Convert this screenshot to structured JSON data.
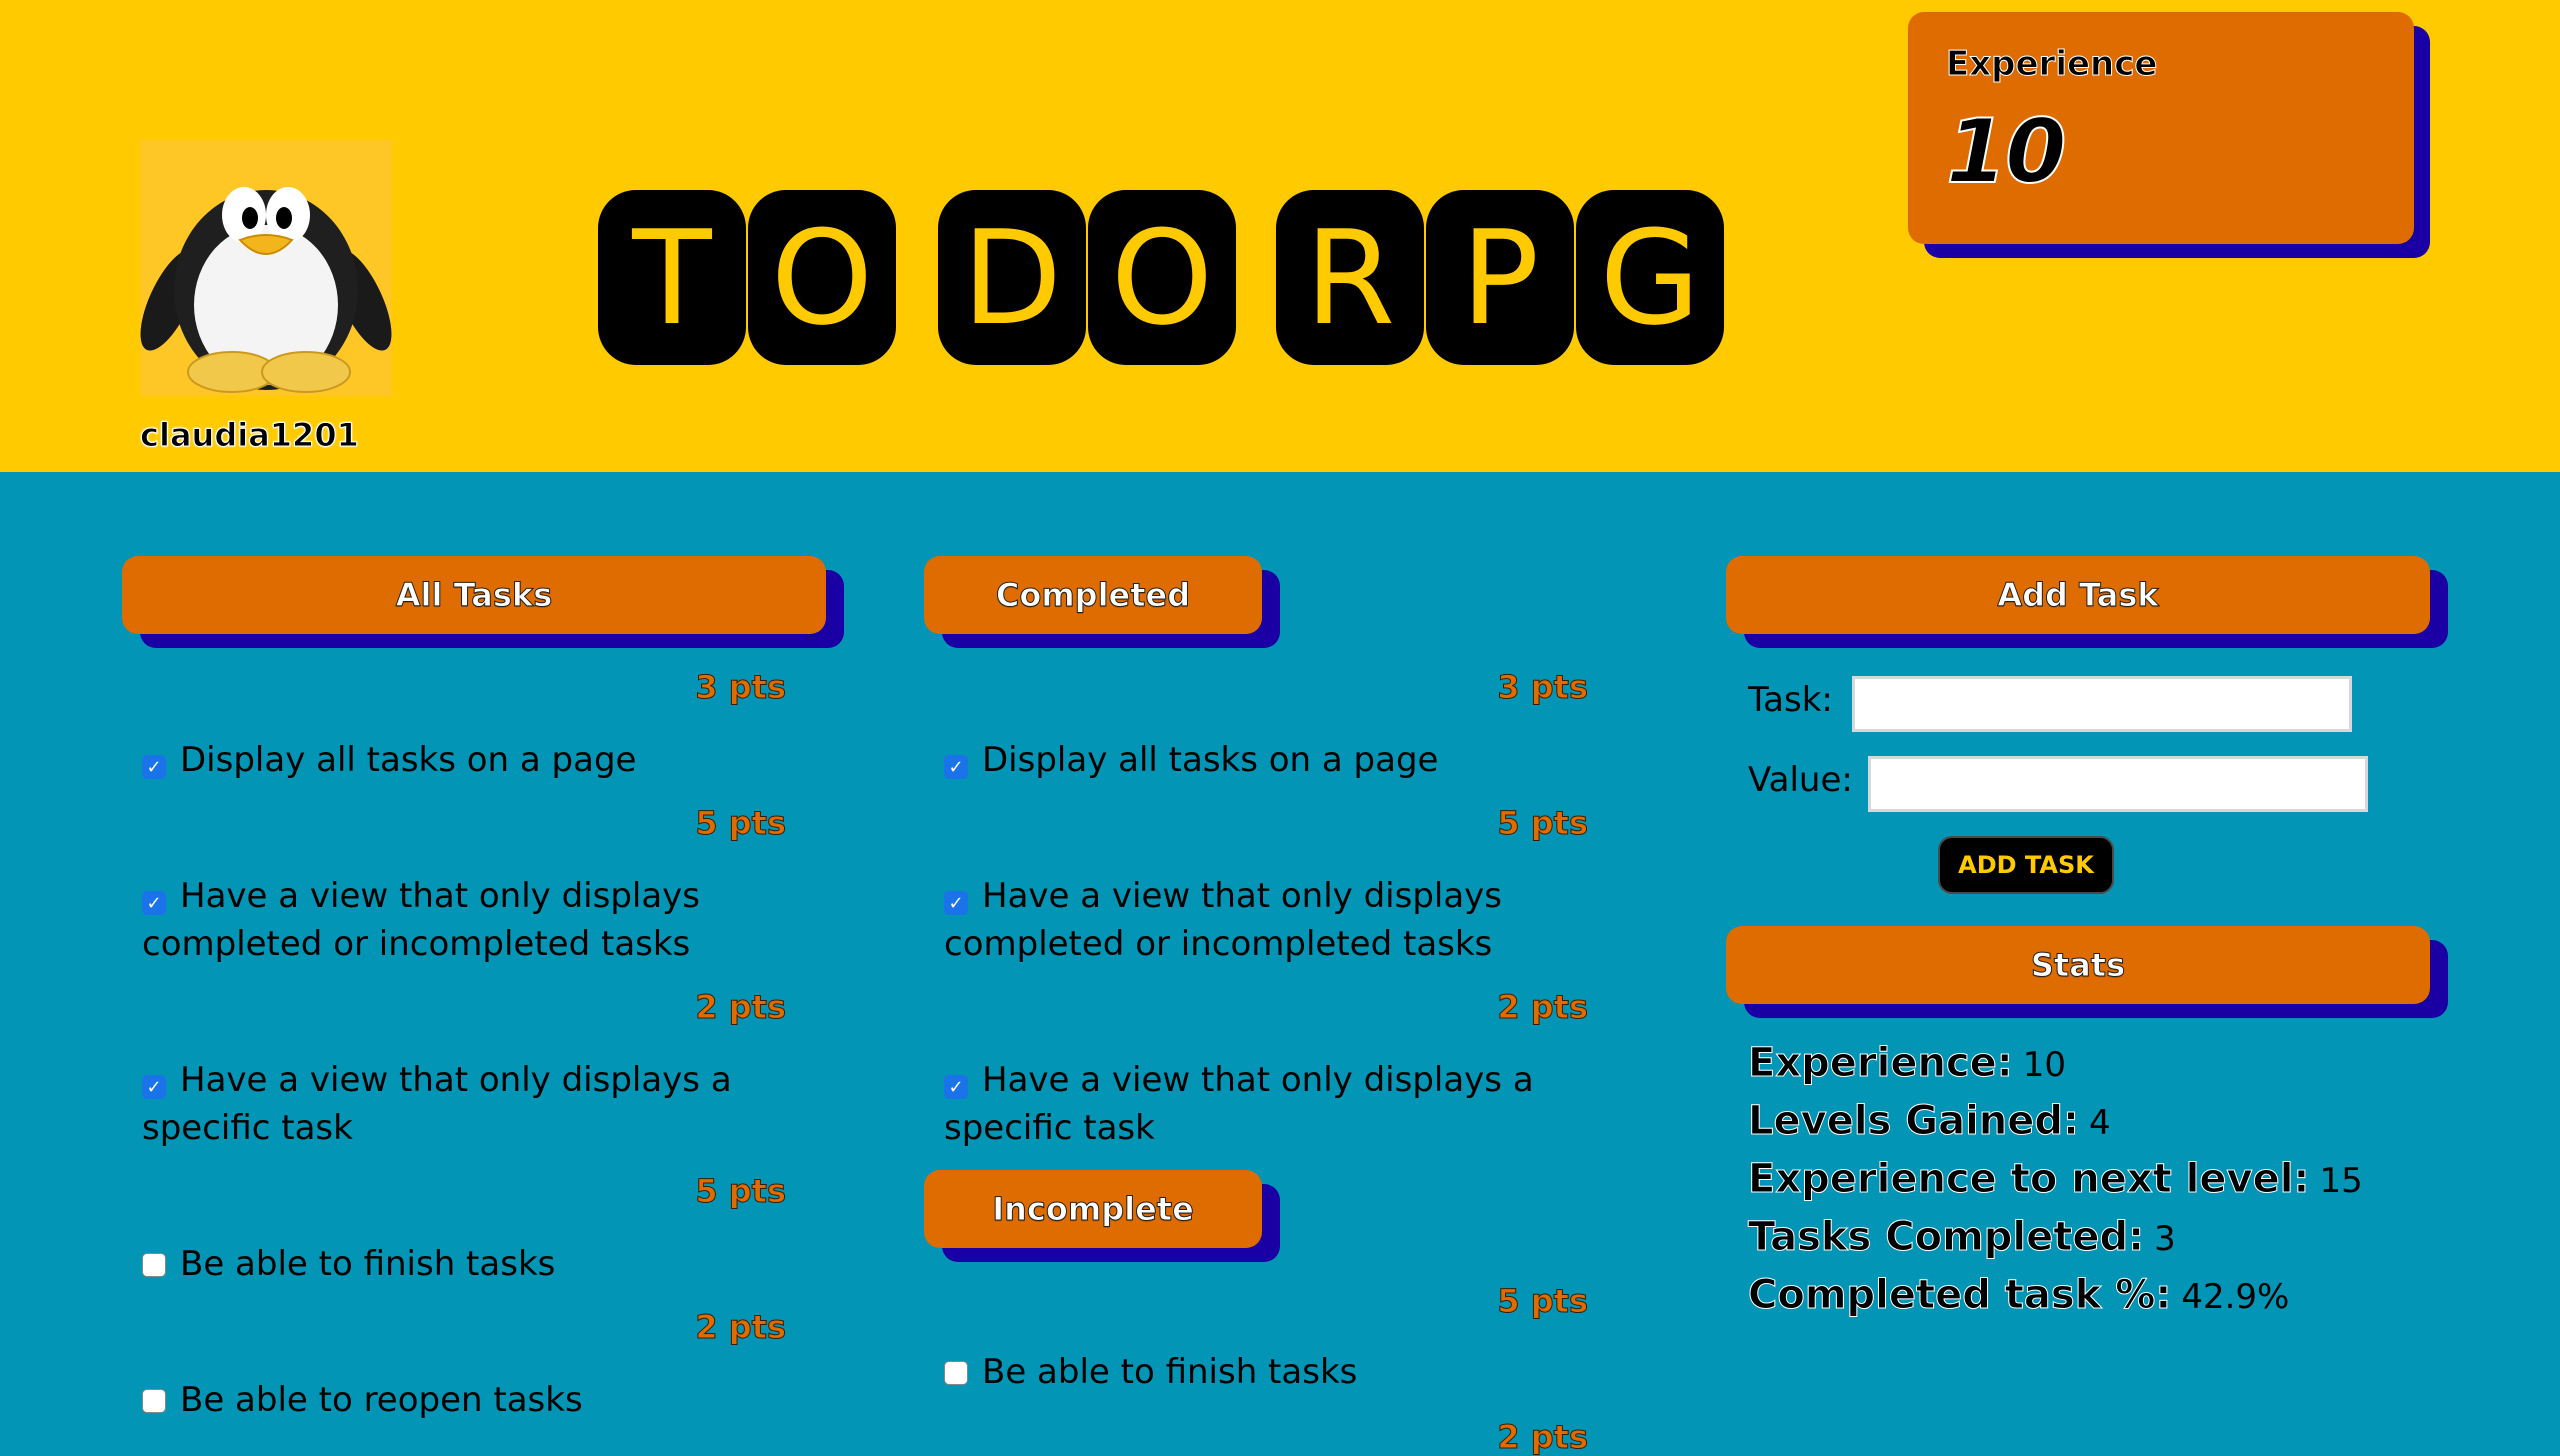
{
  "header": {
    "title_letters": [
      "T",
      "O",
      "D",
      "O",
      "R",
      "P",
      "G"
    ],
    "username": "claudia1201",
    "avatar_icon": "penguin-avatar",
    "experience_label": "Experience",
    "experience_value": "10"
  },
  "all_tasks": {
    "heading": "All Tasks",
    "items": [
      {
        "pts": "3 pts",
        "label": "Display all tasks on a page",
        "checked": true
      },
      {
        "pts": "5 pts",
        "label": "Have a view that only displays completed or incompleted tasks",
        "checked": true
      },
      {
        "pts": "2 pts",
        "label": "Have a view that only displays a specific task",
        "checked": true
      },
      {
        "pts": "5 pts",
        "label": "Be able to finish tasks",
        "checked": false
      },
      {
        "pts": "2 pts",
        "label": "Be able to reopen tasks",
        "checked": false
      }
    ]
  },
  "completed": {
    "heading": "Completed",
    "items": [
      {
        "pts": "3 pts",
        "label": "Display all tasks on a page",
        "checked": true
      },
      {
        "pts": "5 pts",
        "label": "Have a view that only displays completed or incompleted tasks",
        "checked": true
      },
      {
        "pts": "2 pts",
        "label": "Have a view that only displays a specific task",
        "checked": true
      }
    ]
  },
  "incomplete": {
    "heading": "Incomplete",
    "items": [
      {
        "pts": "5 pts",
        "label": "Be able to finish tasks",
        "checked": false
      },
      {
        "pts": "2 pts",
        "label": "",
        "checked": false
      }
    ]
  },
  "add_task": {
    "heading": "Add Task",
    "task_label": "Task:",
    "task_value": "",
    "value_label": "Value:",
    "value_value": "",
    "button_label": "ADD TASK"
  },
  "stats": {
    "heading": "Stats",
    "rows": [
      {
        "label": "Experience:",
        "value": "10"
      },
      {
        "label": "Levels Gained:",
        "value": "4"
      },
      {
        "label": "Experience to next level:",
        "value": "15"
      },
      {
        "label": "Tasks Completed:",
        "value": "3"
      },
      {
        "label": "Completed task %:",
        "value": "42.9%"
      }
    ]
  },
  "colors": {
    "header_bg": "#ffcb00",
    "body_bg": "#0395b5",
    "accent_orange": "#df6c00",
    "shadow_blue": "#1a00a4",
    "checkbox_blue": "#1a73e8"
  }
}
